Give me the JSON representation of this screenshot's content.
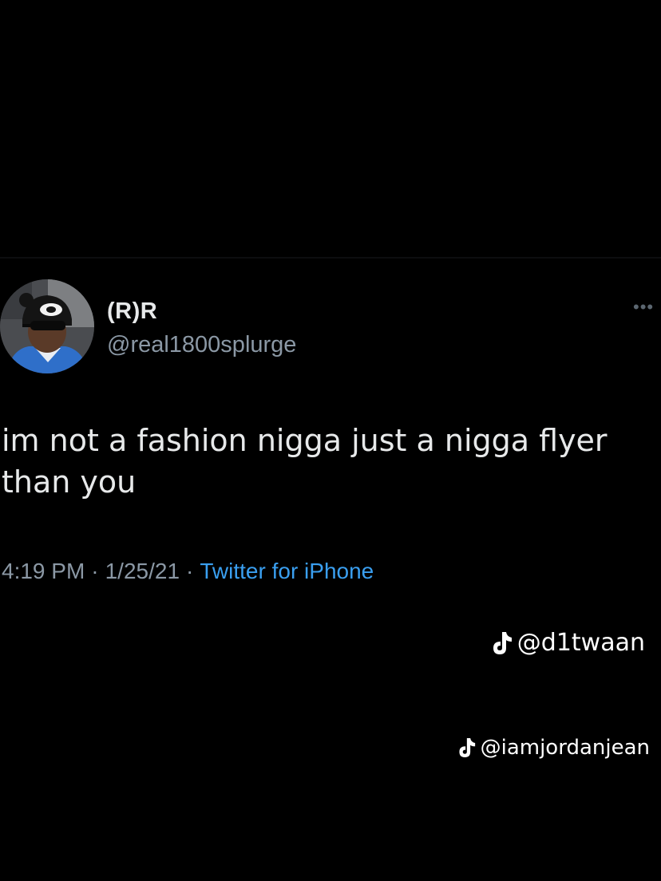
{
  "tweet": {
    "display_name": "(R)R",
    "handle": "@real1800splurge",
    "text": "im not a fashion nigga just a nigga flyer than you",
    "time": "4:19 PM",
    "date": "1/25/21",
    "source": "Twitter for iPhone",
    "more_icon": "more-dots-icon",
    "separator": "·"
  },
  "watermarks": [
    {
      "icon": "tiktok-icon",
      "username": "@d1twaan"
    },
    {
      "icon": "tiktok-icon",
      "username": "@iamjordanjean"
    }
  ],
  "colors": {
    "background": "#000000",
    "primary_text": "#e7e9ea",
    "secondary_text": "#8b98a5",
    "link": "#3a9ff0"
  }
}
